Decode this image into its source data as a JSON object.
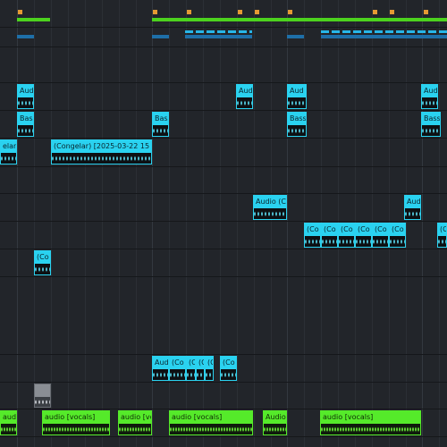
{
  "app": {
    "view": "Arrangement View"
  },
  "colors": {
    "audio_clip": "#2ad2f0",
    "vocal_clip": "#55ea2a",
    "frozen_clip": "#8a8e94",
    "locator": "#e59a33",
    "loop": "#4cd21e"
  },
  "clips": {
    "track_audio": [
      {
        "label": "Aud",
        "state": "visible"
      },
      {
        "label": "Aud",
        "state": "visible"
      },
      {
        "label": "Aud",
        "state": "visible"
      },
      {
        "label": "Aud",
        "state": "visible"
      }
    ],
    "track_bass": [
      {
        "label": "Bass"
      },
      {
        "label": "Bass"
      },
      {
        "label": "Bass"
      },
      {
        "label": "Bass"
      }
    ],
    "track_congelar": [
      {
        "label": "elar)"
      },
      {
        "label": "(Congelar) [2025-03-22 15"
      }
    ],
    "track_audio2": [
      {
        "label": "Audio (Co"
      },
      {
        "label": "Audio ("
      }
    ],
    "track_co_small": [
      {
        "label": "(Co"
      },
      {
        "label": "(Co"
      },
      {
        "label": "(Co"
      },
      {
        "label": "(Co"
      },
      {
        "label": "(Co"
      },
      {
        "label": "(Co"
      },
      {
        "label": "(Co"
      },
      {
        "label": "(Co"
      }
    ],
    "track_single": [
      {
        "label": "(Co"
      }
    ],
    "track_mixed": [
      {
        "label": "Aud"
      },
      {
        "label": "(Co"
      },
      {
        "label": "(C"
      },
      {
        "label": "(C"
      },
      {
        "label": "(C"
      },
      {
        "label": "(Co"
      }
    ],
    "track_frozen": [
      {
        "label": ""
      }
    ],
    "track_vocals": [
      {
        "label": "audio"
      },
      {
        "label": "audio [vocals]"
      },
      {
        "label": "audio [vo"
      },
      {
        "label": "audio [vocals]"
      },
      {
        "label": "Audio"
      },
      {
        "label": "audio [vocals]"
      }
    ]
  }
}
